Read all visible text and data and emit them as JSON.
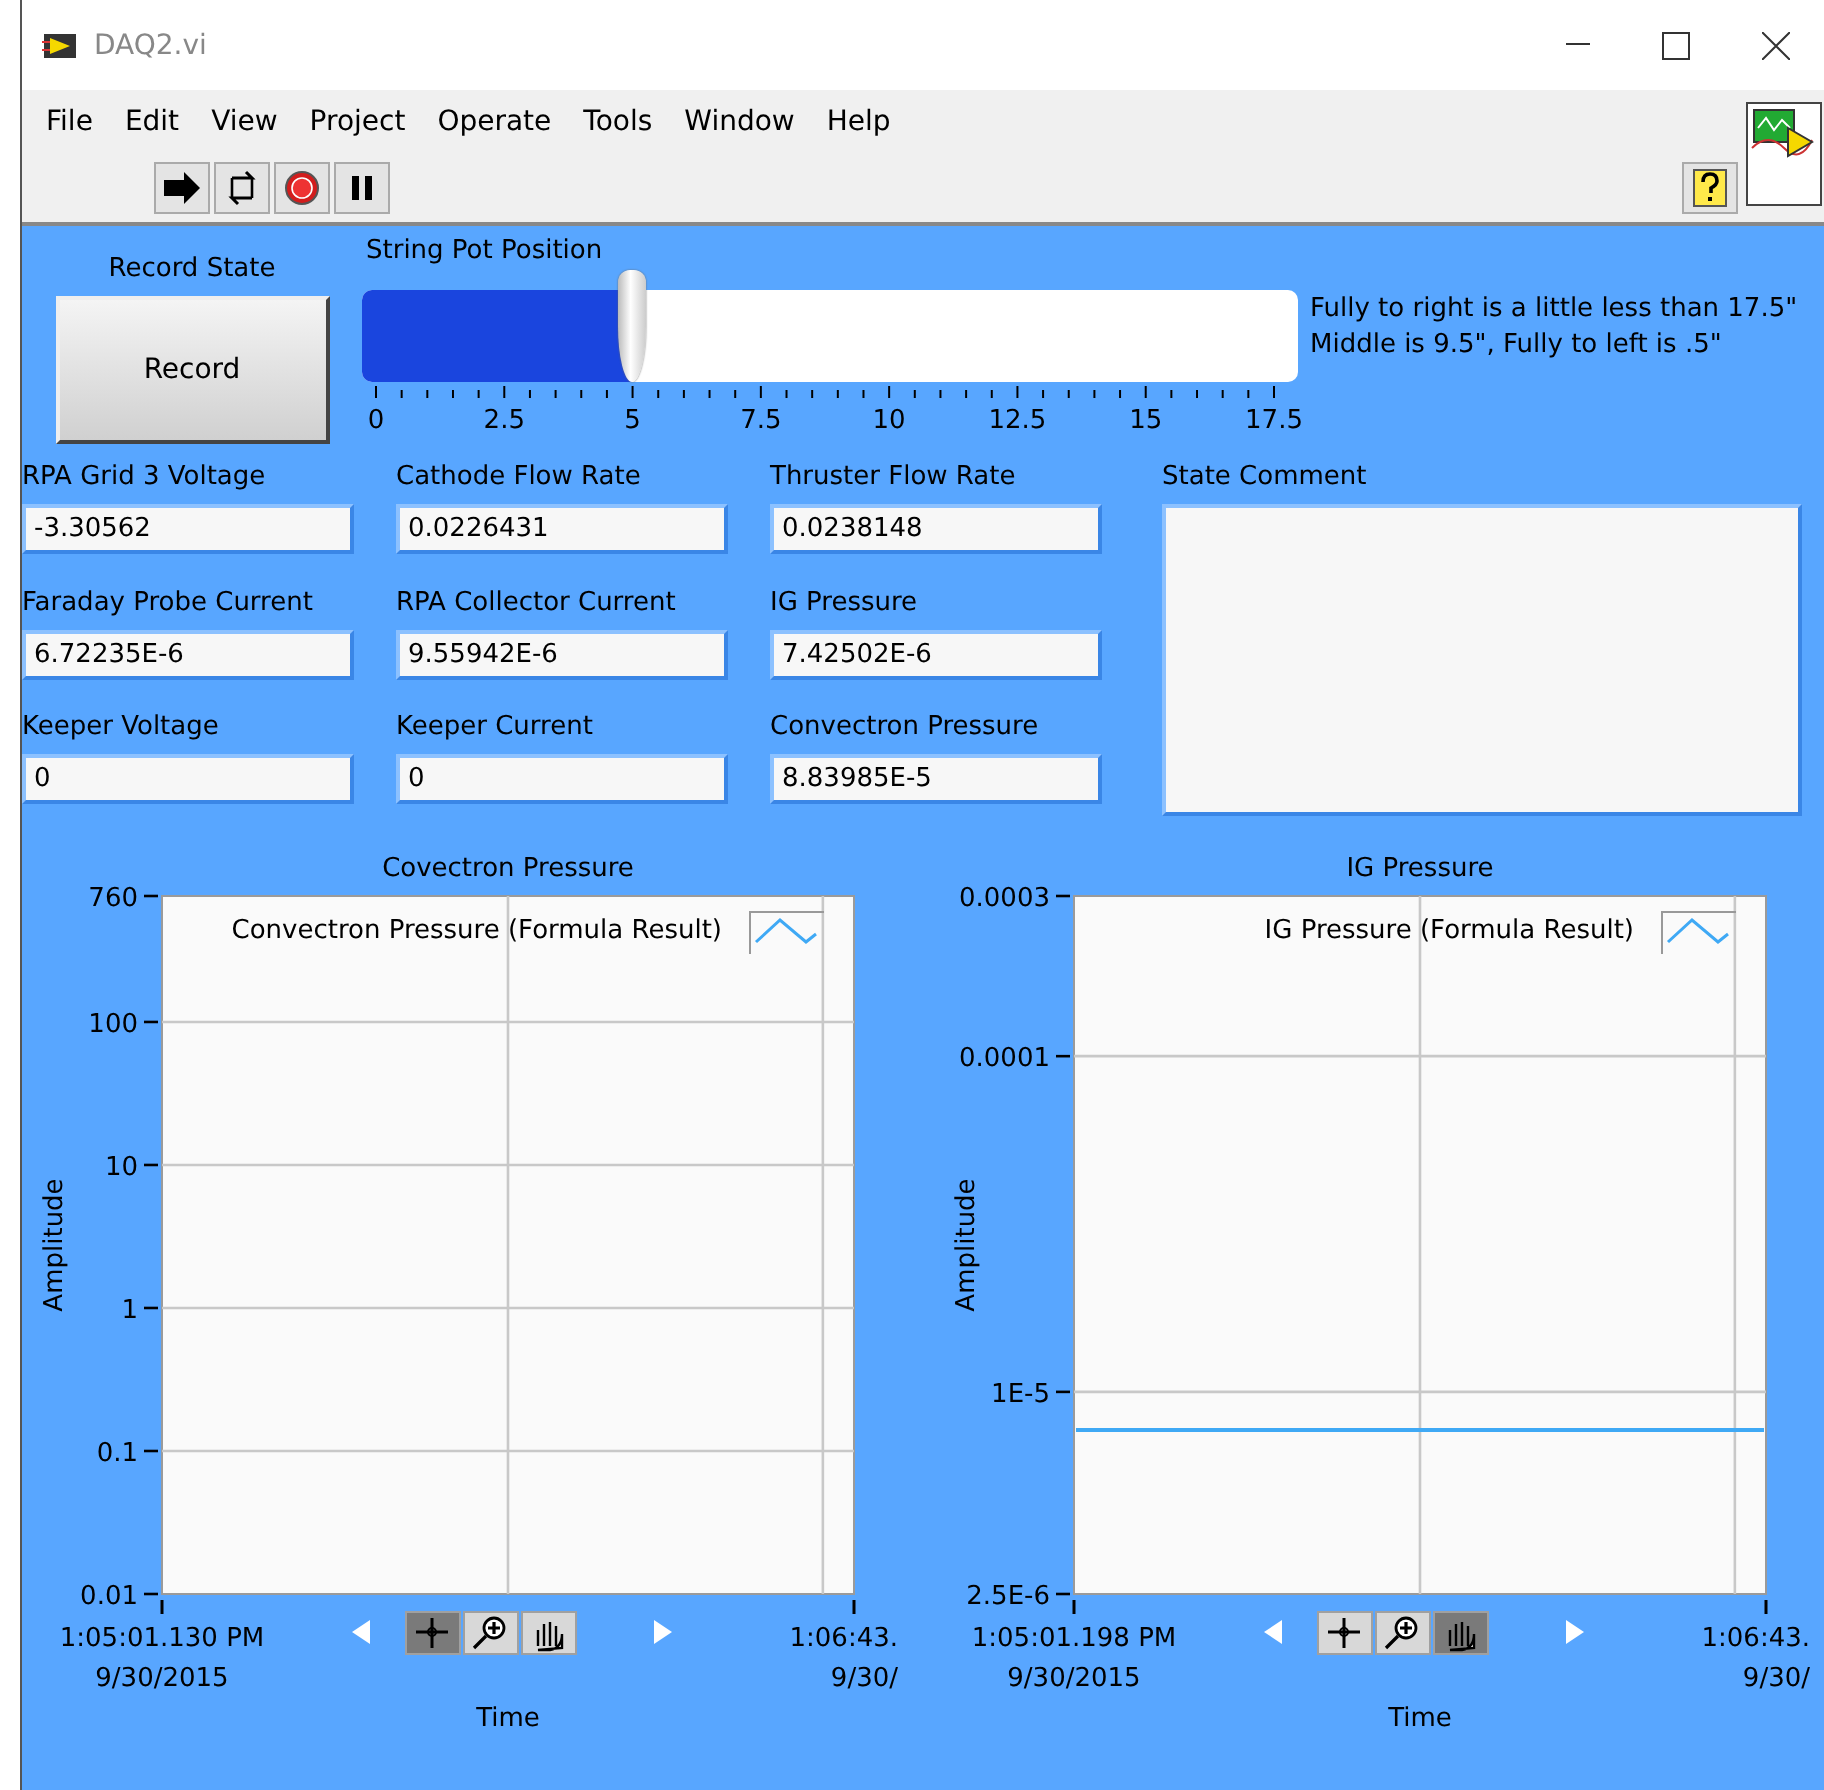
{
  "window": {
    "title": "DAQ2.vi"
  },
  "menu": [
    "File",
    "Edit",
    "View",
    "Project",
    "Operate",
    "Tools",
    "Window",
    "Help"
  ],
  "record": {
    "label": "Record State",
    "button": "Record"
  },
  "slider": {
    "label": "String Pot Position",
    "level": 0.2857,
    "scale": [
      "0",
      "2.5",
      "5",
      "7.5",
      "10",
      "12.5",
      "15",
      "17.5"
    ]
  },
  "note": [
    "Fully to right is a little less than 17.5\"",
    "Middle is 9.5\", Fully to left is .5\""
  ],
  "indicators": [
    {
      "label": "RPA Grid 3 Voltage",
      "value": "-3.30562"
    },
    {
      "label": "Cathode Flow Rate",
      "value": "0.0226431"
    },
    {
      "label": "Thruster Flow Rate",
      "value": "0.0238148"
    },
    {
      "label": "Faraday Probe Current",
      "value": "6.72235E-6"
    },
    {
      "label": "RPA Collector Current",
      "value": "9.55942E-6"
    },
    {
      "label": "IG Pressure",
      "value": "7.42502E-6"
    },
    {
      "label": "Keeper Voltage",
      "value": "0"
    },
    {
      "label": "Keeper Current",
      "value": "0"
    },
    {
      "label": "Convectron Pressure",
      "value": "8.83985E-5"
    }
  ],
  "state_comment": {
    "label": "State Comment"
  },
  "charts": [
    {
      "title": "Covectron Pressure",
      "tools": [
        {
          "kind": "cursor",
          "selected": true
        },
        {
          "kind": "zoom",
          "selected": false
        },
        {
          "kind": "pan",
          "selected": false
        }
      ],
      "legend": [
        {
          "name": "Convectron Pressure (Formula Result)",
          "color": "#3fa9f5",
          "kind": "empty"
        }
      ],
      "y_axis": {
        "label": "Amplitude",
        "ticks": [
          "760",
          "100",
          "10",
          "1",
          "0.1",
          "0.01"
        ]
      },
      "x_axis": {
        "label": "Time",
        "ticks": [
          {
            "time": "1:05:01.130 PM",
            "date": "9/30/2015"
          },
          {
            "time": "1:06:43.",
            "date": "9/30/"
          }
        ]
      }
    },
    {
      "title": "IG Pressure",
      "tools": [
        {
          "kind": "cursor",
          "selected": false
        },
        {
          "kind": "zoom",
          "selected": false
        },
        {
          "kind": "pan",
          "selected": true
        }
      ],
      "legend": [
        {
          "name": "IG Pressure (Formula Result)",
          "color": "#3fa9f5",
          "kind": "trace"
        }
      ],
      "y_axis": {
        "label": "Amplitude",
        "ticks": [
          "0.0003",
          "0.0001",
          "1E-5",
          "2.5E-6"
        ]
      },
      "x_axis": {
        "label": "Time",
        "ticks": [
          {
            "time": "1:05:01.198 PM",
            "date": "9/30/2015"
          },
          {
            "time": "1:06:43.",
            "date": "9/30/"
          }
        ]
      }
    }
  ]
}
